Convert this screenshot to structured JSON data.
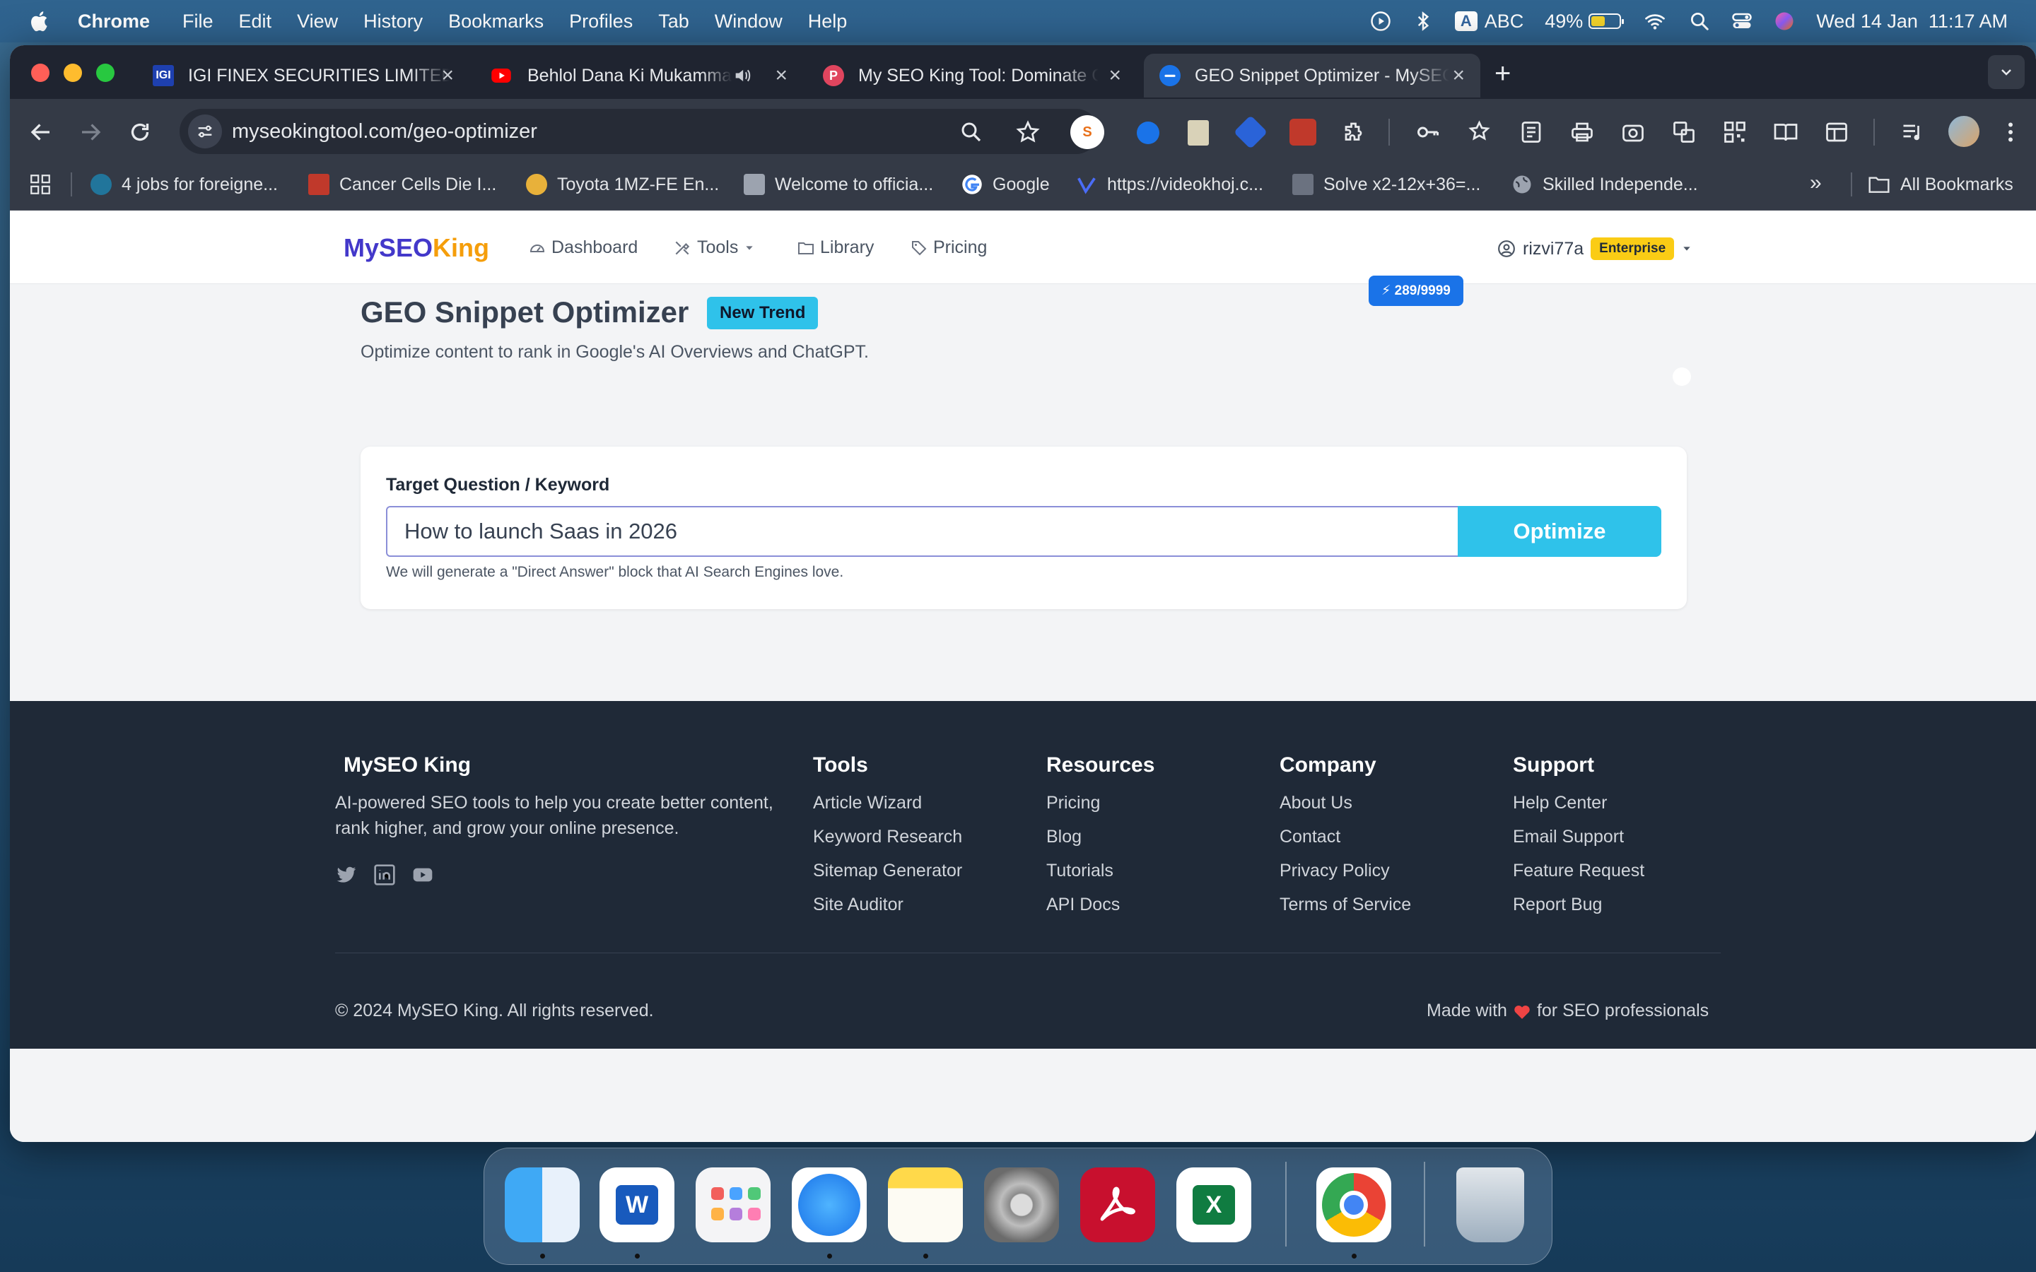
{
  "menubar": {
    "app_name": "Chrome",
    "items": [
      "File",
      "Edit",
      "View",
      "History",
      "Bookmarks",
      "Profiles",
      "Tab",
      "Window",
      "Help"
    ],
    "input_source": "ABC",
    "input_letter": "A",
    "battery": "49%",
    "battery_level": 0.49,
    "datetime": "Wed 14 Jan  11:17 AM"
  },
  "browser": {
    "tabs": [
      {
        "title": "IGI FINEX SECURITIES LIMITED",
        "favicon": "IGI",
        "color": "#1e40af"
      },
      {
        "title": "Behlol Dana Ki Mukammal",
        "favicon": "youtube",
        "color": "#ff0000"
      },
      {
        "title": "My SEO King Tool: Dominate Google",
        "favicon": "P",
        "color": "#e0455e"
      },
      {
        "title": "GEO Snippet Optimizer - MySEO King",
        "favicon": "globe",
        "color": "#1a73e8",
        "active": true
      }
    ],
    "url": "myseokingtool.com/geo-optimizer",
    "bookmarks": [
      {
        "label": "4 jobs for foreigne...",
        "color": "#21759b"
      },
      {
        "label": "Cancer Cells Die I...",
        "color": "#c0392b"
      },
      {
        "label": "Toyota 1MZ-FE En...",
        "color": "#e8b13a"
      },
      {
        "label": "Welcome to officia...",
        "color": "#9ca3af"
      },
      {
        "label": "Google",
        "color": "#4285f4"
      },
      {
        "label": "https://videokhoj.c...",
        "color": "#4a6cf7"
      },
      {
        "label": "Solve x2-12x+36=...",
        "color": "#6b7280"
      },
      {
        "label": "Skilled Independe...",
        "color": "#9ca3af"
      }
    ],
    "all_bookmarks": "All Bookmarks"
  },
  "site": {
    "logo_part1": "MySEO",
    "logo_part2": "King",
    "nav": [
      "Dashboard",
      "Tools",
      "Library",
      "Pricing"
    ],
    "credits": "289/9999",
    "username": "rizvi77a",
    "plan": "Enterprise"
  },
  "main": {
    "title": "GEO Snippet Optimizer",
    "badge": "New Trend",
    "subtitle": "Optimize content to rank in Google's AI Overviews and ChatGPT.",
    "field_label": "Target Question / Keyword",
    "field_value": "How to launch Saas in 2026",
    "button": "Optimize",
    "hint": "We will generate a \"Direct Answer\" block that AI Search Engines love."
  },
  "footer": {
    "brand": "MySEO King",
    "description": "AI-powered SEO tools to help you create better content, rank higher, and grow your online presence.",
    "columns": [
      {
        "heading": "Tools",
        "links": [
          "Article Wizard",
          "Keyword Research",
          "Sitemap Generator",
          "Site Auditor"
        ]
      },
      {
        "heading": "Resources",
        "links": [
          "Pricing",
          "Blog",
          "Tutorials",
          "API Docs"
        ]
      },
      {
        "heading": "Company",
        "links": [
          "About Us",
          "Contact",
          "Privacy Policy",
          "Terms of Service"
        ]
      },
      {
        "heading": "Support",
        "links": [
          "Help Center",
          "Email Support",
          "Feature Request",
          "Report Bug"
        ]
      }
    ],
    "copyright": "© 2024 MySEO King. All rights reserved.",
    "made_with_pre": "Made with",
    "made_with_post": "for SEO professionals"
  },
  "dock": {
    "apps": [
      "finder-icon",
      "word-icon",
      "launchpad-icon",
      "safari-icon",
      "notes-icon",
      "settings-icon",
      "acrobat-icon",
      "excel-icon",
      "chrome-icon",
      "trash-icon"
    ]
  }
}
